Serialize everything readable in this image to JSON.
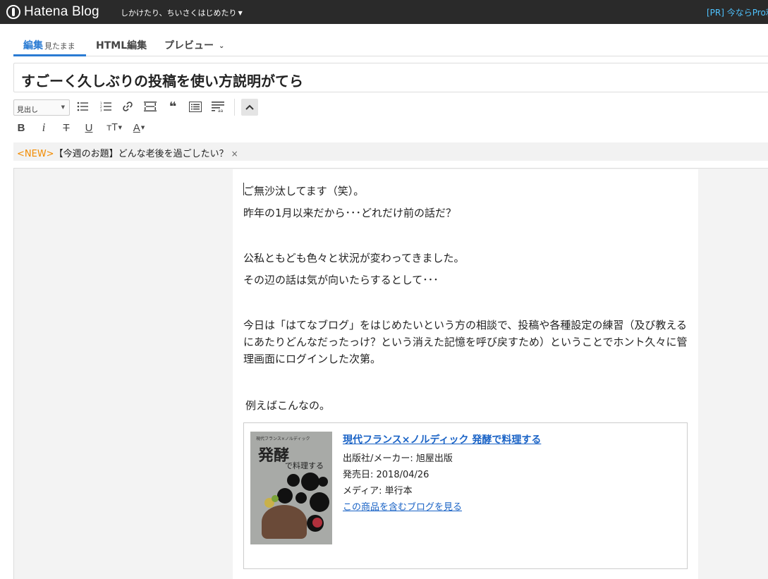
{
  "app": {
    "logo": "Hatena Blog",
    "blog_name": "しかけたり、ちいさくはじめたり",
    "pr_link": "[PR] 今ならPro利"
  },
  "tabs": [
    {
      "label": "編集",
      "sub": "見たまま"
    },
    {
      "label": "HTML編集"
    },
    {
      "label": "プレビュー"
    }
  ],
  "title": "すごーく久しぶりの投稿を使い方説明がてら",
  "toolbar": {
    "format_select": "見出し",
    "row1_icons": [
      "unordered-list-icon",
      "ordered-list-icon",
      "link-icon",
      "more-separator-icon",
      "blockquote-icon",
      "table-of-contents-icon",
      "footnote-icon"
    ],
    "row2_icons": [
      "bold-icon",
      "italic-icon",
      "strikethrough-icon",
      "underline-icon",
      "font-size-icon",
      "text-color-icon"
    ],
    "row2_glyphs": [
      "B",
      "i",
      "T",
      "U",
      "тT",
      "A"
    ]
  },
  "notice": {
    "badge": "<NEW>",
    "text": "【今週のお題】どんな老後を過ごしたい？",
    "close": "×"
  },
  "body": {
    "p1": "ご無沙汰してます（笑）。",
    "p2": "昨年の1月以来だから･･･どれだけ前の話だ？",
    "p3": "公私ともども色々と状況が変わってきました。",
    "p4": "その辺の話は気が向いたらするとして･･･",
    "p5": "今日は「はてなブログ」をはじめたいという方の相談で、投稿や各種設定の練習（及び教えるにあたりどんなだったっけ？という消えた記憶を呼び戻すため）ということでホント久々に管理画面にログインした次第。",
    "p6": "例えばこんなの。"
  },
  "product": {
    "title": "現代フランス×ノルディック 発酵で料理する",
    "publisher": "出版社/メーカー: 旭屋出版",
    "release": "発売日: 2018/04/26",
    "media": "メディア: 単行本",
    "more_link": "この商品を含むブログを見る",
    "cover_series": "現代フランス×ノルディック",
    "cover_title": "発酵",
    "cover_subtitle": "で料理する"
  }
}
